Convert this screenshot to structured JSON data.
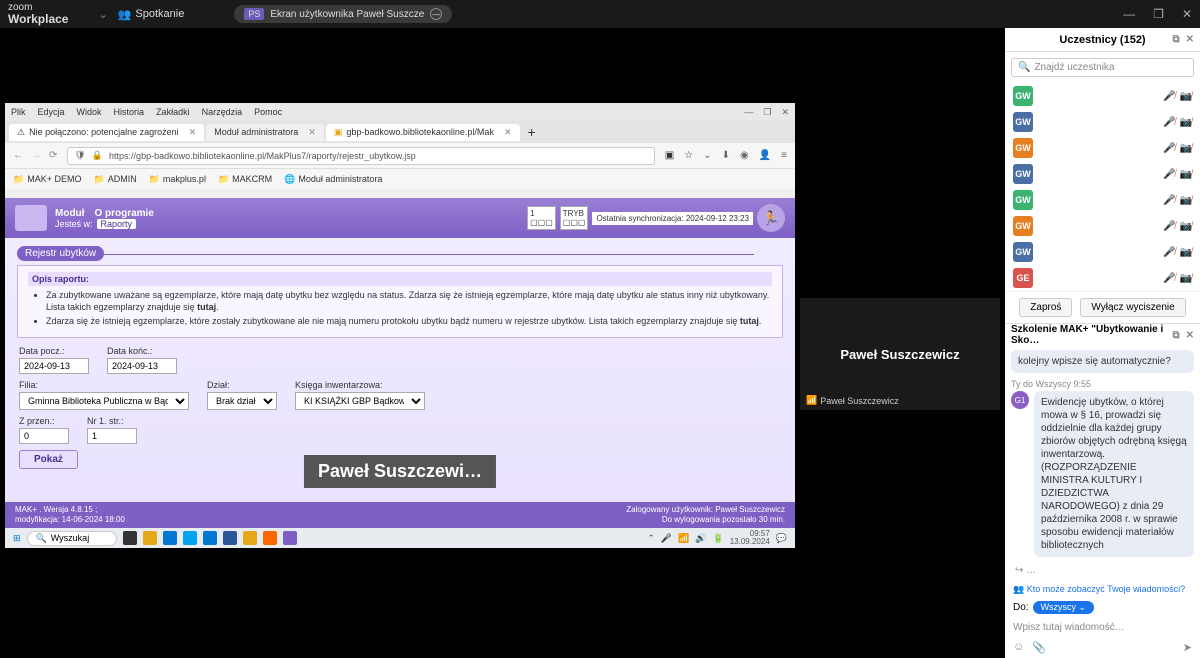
{
  "zoom": {
    "brand1": "zoom",
    "brand2": "Workplace",
    "meeting": "Spotkanie",
    "share_badge": "PS",
    "share_text": "Ekran użytkownika Paweł Suszcze",
    "win_min": "—",
    "win_max": "❐",
    "win_close": "✕"
  },
  "browser": {
    "menu": [
      "Plik",
      "Edycja",
      "Widok",
      "Historia",
      "Zakładki",
      "Narzędzia",
      "Pomoc"
    ],
    "tab1": "Nie połączono: potencjalne zagrożeni",
    "tab1_pre": "⚠",
    "tab2": "gbp-badkowo.bibliotekaonline.pl/Mak",
    "tab3": "Moduł administratora",
    "url": "https://gbp-badkowo.bibliotekaonline.pl/MakPlus7/raporty/rejestr_ubytkow.jsp",
    "bookmarks": [
      "MAK+ DEMO",
      "ADMIN",
      "makplus.pl",
      "MAKCRM",
      "Moduł administratora"
    ]
  },
  "app": {
    "modul": "Moduł",
    "oprog": "O programie",
    "jestes": "Jesteś w:",
    "raporty": "Raporty",
    "sync": "Ostatnia synchronizacja: 2024-09-12 23:23",
    "title": "Rejestr ubytków",
    "opis_hdr": "Opis raportu:",
    "b1": "Za zubytkowane uważane są egzemplarze, które mają datę ubytku bez względu na status. Zdarza się że istnieją egzemplarze, które mają datę ubytku ale status inny niż ubytkowany. Lista takich egzemplarzy znajduje się ",
    "b1b": "tutaj",
    "b2": "Zdarza się że istnieją egzemplarze, które zostały zubytkowane ale nie mają numeru protokołu ubytku bądź numeru w rejestrze ubytków. Lista takich egzemplarzy znajduje się ",
    "b2b": "tutaj",
    "labels": {
      "data_pocz": "Data pocz.:",
      "data_konc": "Data końc.:",
      "filia": "Filia:",
      "dzial": "Dział:",
      "ksiega": "Księga inwentarzowa:",
      "zprzen": "Z przen.:",
      "nr1": "Nr 1. str.:"
    },
    "values": {
      "data_pocz": "2024-09-13",
      "data_konc": "2024-09-13",
      "filia": "Gminna Biblioteka Publiczna w Bądkowie",
      "dzial": "Brak działu",
      "ksiega": "KI KSIĄŻKI GBP Bądkowo",
      "zprzen": "0",
      "nr1": "1"
    },
    "pokaz": "Pokaż",
    "overlay": "Paweł  Suszczewi…",
    "footer_l1": "MAK+ .  Wersja 4.8.15 ;",
    "footer_l2": "modyfikacja: 14-06-2024 18:00",
    "footer_r1": "Zalogowany użytkownik:  Paweł Suszczewicz",
    "footer_r2": "Do wylogowania pozostało 30 min."
  },
  "taskbar": {
    "search": "Wyszukaj",
    "time": "09:57",
    "date": "13.09.2024"
  },
  "video": {
    "name": "Paweł Suszczewicz",
    "label": "Paweł Suszczewicz"
  },
  "participants": {
    "title": "Uczestnicy (152)",
    "search_ph": "Znajdź uczestnika",
    "invite": "Zaproś",
    "mute": "Wyłącz wyciszenie",
    "list": [
      {
        "initials": "GW",
        "color": "#3cb371"
      },
      {
        "initials": "GW",
        "color": "#4a6fa5"
      },
      {
        "initials": "GW",
        "color": "#e67e22"
      },
      {
        "initials": "GW",
        "color": "#4a6fa5"
      },
      {
        "initials": "GW",
        "color": "#3cb371"
      },
      {
        "initials": "GW",
        "color": "#e67e22"
      },
      {
        "initials": "GW",
        "color": "#4a6fa5"
      },
      {
        "initials": "GE",
        "color": "#d9534f"
      }
    ]
  },
  "chat": {
    "header": "Szkolenie MAK+ \"Ubytkowanie i Sko…",
    "msg0": "kolejny wpisze się automatycznie?",
    "meta1": "Ty do Wszyscy 9:55",
    "msg1": "Ewidencję ubytków, o której mowa w § 16, prowadzi się oddzielnie dla każdej grupy zbiorów objętych odrębną księgą inwentarzową. (ROZPORZĄDZENIE MINISTRA KULTURY I DZIEDZICTWA NARODOWEGO) z dnia 29 października 2008 r. w sprawie sposobu ewidencji materiałów bibliotecznych",
    "who_see": "Kto może zobaczyć Twoje wiadomości?",
    "to_label": "Do:",
    "to_value": "Wszyscy ⌄",
    "input_ph": "Wpisz tutaj wiadomość…"
  }
}
